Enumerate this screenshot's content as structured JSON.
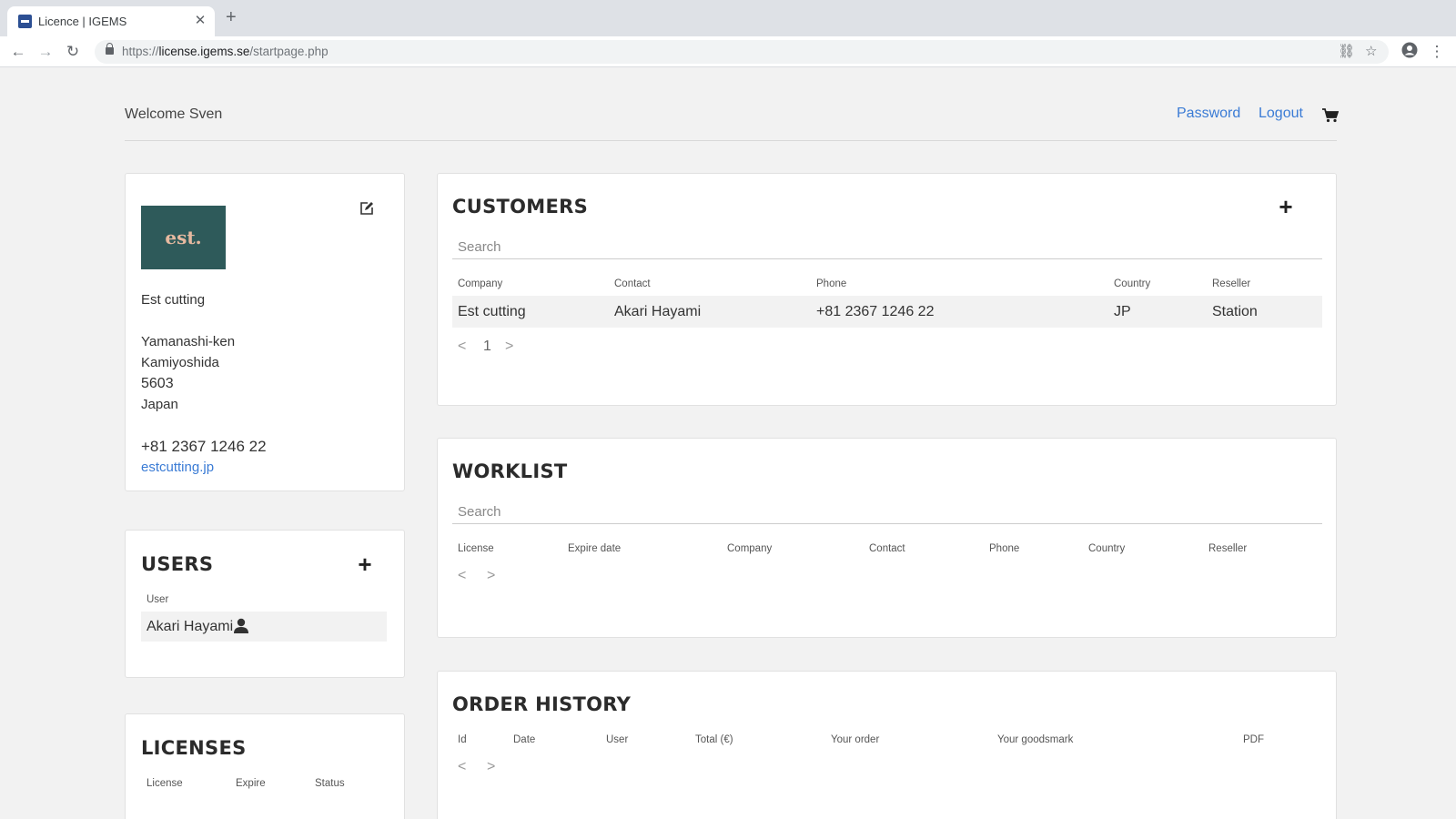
{
  "browser": {
    "tab_title": "Licence | IGEMS",
    "tab_close": "✕",
    "new_tab": "+",
    "url_scheme": "https://",
    "url_host": "license.igems.se",
    "url_path": "/startpage.php"
  },
  "header": {
    "welcome": "Welcome Sven",
    "password_link": "Password",
    "logout_link": "Logout"
  },
  "company": {
    "logo_text": "est.",
    "name": "Est cutting",
    "address_line1": "Yamanashi-ken",
    "address_line2": "Kamiyoshida",
    "postal_code": "5603",
    "country": "Japan",
    "phone": "+81 2367 1246 22",
    "website": "estcutting.jp"
  },
  "users": {
    "title": "USERS",
    "column": "User",
    "rows": [
      {
        "name": "Akari Hayami"
      }
    ]
  },
  "licenses": {
    "title": "LICENSES",
    "columns": [
      "License",
      "Expire",
      "Status"
    ]
  },
  "customers": {
    "title": "CUSTOMERS",
    "search_placeholder": "Search",
    "columns": [
      "Company",
      "Contact",
      "Phone",
      "Country",
      "Reseller"
    ],
    "rows": [
      {
        "company": "Est cutting",
        "contact": "Akari Hayami",
        "phone": "+81 2367 1246 22",
        "country": "JP",
        "reseller": "Station"
      }
    ],
    "pager": {
      "prev": "<",
      "page": "1",
      "next": ">"
    }
  },
  "worklist": {
    "title": "WORKLIST",
    "search_placeholder": "Search",
    "columns": [
      "License",
      "Expire date",
      "Company",
      "Contact",
      "Phone",
      "Country",
      "Reseller"
    ],
    "pager": {
      "prev": "<",
      "next": ">"
    }
  },
  "order_history": {
    "title": "ORDER HISTORY",
    "columns": [
      "Id",
      "Date",
      "User",
      "Total (€)",
      "Your order",
      "Your goodsmark",
      "PDF"
    ],
    "pager": {
      "prev": "<",
      "next": ">"
    }
  },
  "colors": {
    "link": "#3a7bd5",
    "logo_bg": "#2e5a5a",
    "logo_text": "#e6b9a0"
  }
}
